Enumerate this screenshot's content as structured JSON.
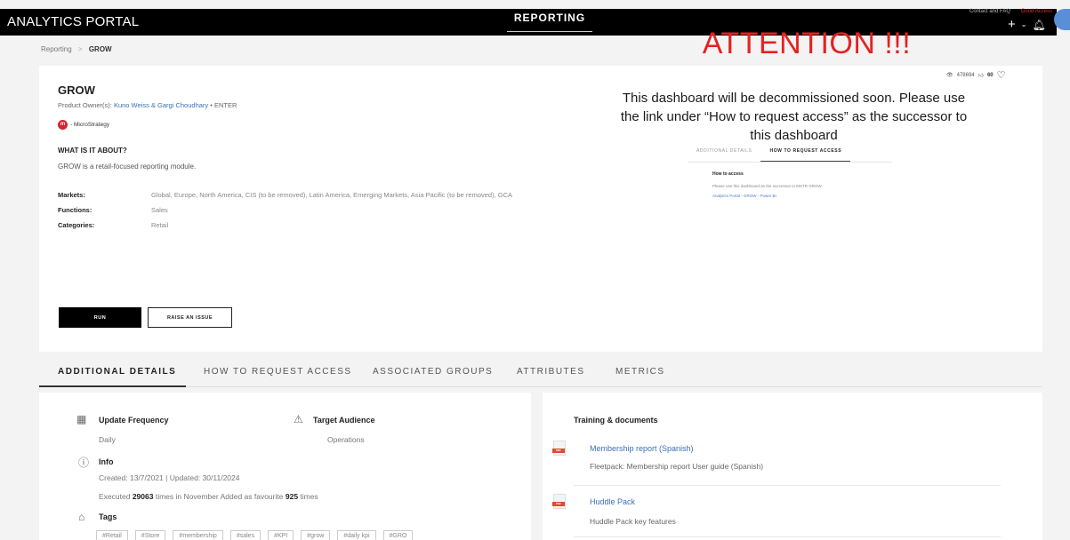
{
  "header": {
    "logo": "ANALYTICS PORTAL",
    "nav_center": "REPORTING",
    "contact_link": "Contact and FAQ",
    "red_link": "Good Access",
    "plus_icon": "plus-icon",
    "bell_icon": "bell-icon"
  },
  "breadcrumb": {
    "parent": "Reporting",
    "separator": ">",
    "current": "GROW"
  },
  "product": {
    "title": "GROW",
    "owners_label": "Product Owner(s):",
    "owner1": "Kuno Weiss",
    "owner_sep": "&",
    "owner2": "Gargi Choudhary",
    "owner_tail": "• ENTER",
    "platform": "- MicroStrategy",
    "about_heading": "WHAT IS IT ABOUT?",
    "about_text": "GROW is a retail-focused reporting module.",
    "markets_label": "Markets:",
    "markets_value": "Global, Europe, North America, CIS (to be removed), Latin America, Emerging Markets, Asia Pacific (to be removed), GCA",
    "functions_label": "Functions:",
    "functions_value": "Sales",
    "categories_label": "Categories:",
    "categories_value": "Retail",
    "run_label": "RUN",
    "issue_label": "RAISE AN ISSUE",
    "views": "478694",
    "likes": "60"
  },
  "attention": {
    "heading": "ATTENTION !!!",
    "message": "This dashboard will be decommissioned soon. Please use the link under “How to request access” as the successor to this dashboard",
    "inset_tab1": "ADDITIONAL DETAILS",
    "inset_tab2": "HOW TO REQUEST ACCESS",
    "inset_heading": "How to access",
    "inset_text": "Please use this dashboard as the successor to MSTR GROW",
    "inset_link": "Analytics Portal - GROW - Power BI"
  },
  "tabs": [
    {
      "label": "ADDITIONAL DETAILS"
    },
    {
      "label": "HOW TO REQUEST ACCESS"
    },
    {
      "label": "ASSOCIATED GROUPS"
    },
    {
      "label": "ATTRIBUTES"
    },
    {
      "label": "METRICS"
    }
  ],
  "details": {
    "update_label": "Update Frequency",
    "update_value": "Daily",
    "audience_label": "Target Audience",
    "audience_value": "Operations",
    "info_label": "Info",
    "info_dates": "Created: 13/7/2021 | Updated: 30/11/2024",
    "executed_prefix": "Executed",
    "executed_count": "29063",
    "executed_mid": "times in November   Added as favourite",
    "favourite_count": "925",
    "executed_suffix": "times",
    "tags_label": "Tags",
    "tags": [
      "#Retail",
      "#Store",
      "#membership",
      "#sales",
      "#KPI",
      "#grow",
      "#daily kpi",
      "#GRO"
    ]
  },
  "documents": {
    "title": "Training & documents",
    "items": [
      {
        "name": "Membership report (Spanish)",
        "desc": "Fleetpack: Membership report User guide (Spanish)"
      },
      {
        "name": "Huddle Pack",
        "desc": "Huddle Pack key features"
      }
    ]
  }
}
